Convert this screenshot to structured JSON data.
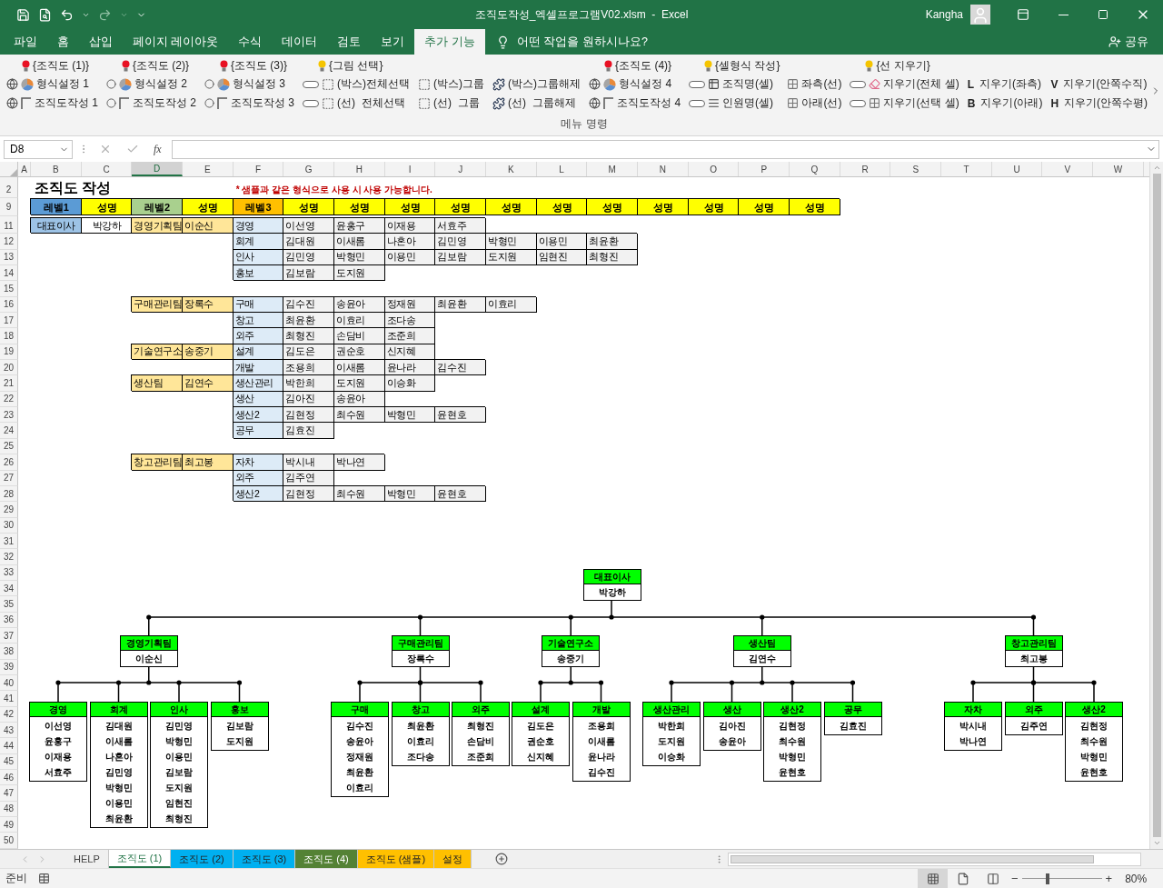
{
  "title_bar": {
    "title": "조직도작성_엑셀프로그램V02.xlsm  -  Excel",
    "user": "Kangha"
  },
  "tabs": [
    {
      "label": "파일",
      "selected": false
    },
    {
      "label": "홈",
      "selected": false
    },
    {
      "label": "삽입",
      "selected": false
    },
    {
      "label": "페이지 레이아웃",
      "selected": false
    },
    {
      "label": "수식",
      "selected": false
    },
    {
      "label": "데이터",
      "selected": false
    },
    {
      "label": "검토",
      "selected": false
    },
    {
      "label": "보기",
      "selected": false
    },
    {
      "label": "추가 기능",
      "selected": true
    }
  ],
  "tell_me": {
    "placeholder": "어떤 작업을 원하시나요?"
  },
  "share": "공유",
  "ribbon": {
    "columns": [
      {
        "heading": {
          "label": "{조직도 (1)}",
          "color": "#e81123"
        },
        "buttons": [
          {
            "label": "형식설정 1"
          },
          {
            "label": "조직도작성 1"
          }
        ]
      },
      {
        "heading": {
          "label": "{조직도 (2)}",
          "color": "#e81123"
        },
        "buttons": [
          {
            "label": "형식설정 2"
          },
          {
            "label": "조직도작성 2"
          }
        ]
      },
      {
        "heading": {
          "label": "{조직도 (3)}",
          "color": "#e81123"
        },
        "buttons": [
          {
            "label": "형식설정 3"
          },
          {
            "label": "조직도작성 3"
          }
        ]
      },
      {
        "heading": {
          "label": "{그림 선택}",
          "color": "#f5c400"
        },
        "buttons": [
          {
            "label": "(박스)전체선택"
          },
          {
            "label": "(선)  전체선택"
          }
        ]
      },
      {
        "buttons": [
          {
            "label": "(박스)그룹"
          },
          {
            "label": "(선)  그룹"
          }
        ]
      },
      {
        "buttons": [
          {
            "label": "(박스)그룹해제"
          },
          {
            "label": "(선)  그룹해제"
          }
        ]
      },
      {
        "heading": {
          "label": "{조직도 (4)}",
          "color": "#e81123"
        },
        "buttons": [
          {
            "label": "형식설정 4"
          },
          {
            "label": "조직도작성 4"
          }
        ]
      },
      {
        "heading": {
          "label": "{셀형식 작성}",
          "color": "#f5c400"
        },
        "buttons": [
          {
            "label": "조직명(셀)"
          },
          {
            "label": "인원명(셀)"
          }
        ]
      },
      {
        "buttons": [
          {
            "label": "좌측(선)"
          },
          {
            "label": "아래(선)"
          }
        ]
      },
      {
        "heading": {
          "label": "{선 지우기}",
          "color": "#f5c400"
        },
        "buttons": [
          {
            "label": "지우기(전체 셀)"
          },
          {
            "label": "지우기(선택 셀)"
          }
        ]
      },
      {
        "buttons": [
          {
            "letter": "L",
            "label": "지우기(좌측)"
          },
          {
            "letter": "B",
            "label": "지우기(아래)"
          }
        ]
      },
      {
        "buttons": [
          {
            "letter": "V",
            "label": "지우기(안쪽수직)"
          },
          {
            "letter": "H",
            "label": "지우기(안쪽수평)"
          }
        ]
      }
    ],
    "group_label": "메뉴 명령"
  },
  "formula_bar": {
    "name_box": "D8",
    "function_button": "fx"
  },
  "columns": [
    {
      "label": "A",
      "selected": false
    },
    {
      "label": "B",
      "selected": false
    },
    {
      "label": "C",
      "selected": false
    },
    {
      "label": "D",
      "selected": true
    },
    {
      "label": "E",
      "selected": false
    },
    {
      "label": "F",
      "selected": false
    },
    {
      "label": "G",
      "selected": false
    },
    {
      "label": "H",
      "selected": false
    },
    {
      "label": "I",
      "selected": false
    },
    {
      "label": "J",
      "selected": false
    },
    {
      "label": "K",
      "selected": false
    },
    {
      "label": "L",
      "selected": false
    },
    {
      "label": "M",
      "selected": false
    },
    {
      "label": "N",
      "selected": false
    },
    {
      "label": "O",
      "selected": false
    },
    {
      "label": "P",
      "selected": false
    },
    {
      "label": "Q",
      "selected": false
    },
    {
      "label": "R",
      "selected": false
    },
    {
      "label": "S",
      "selected": false
    },
    {
      "label": "T",
      "selected": false
    },
    {
      "label": "U",
      "selected": false
    },
    {
      "label": "V",
      "selected": false
    },
    {
      "label": "W",
      "selected": false
    }
  ],
  "row_numbers": [
    "2",
    "9",
    "11",
    "12",
    "13",
    "14",
    "15",
    "16",
    "17",
    "18",
    "19",
    "20",
    "21",
    "22",
    "23",
    "24",
    "25",
    "26",
    "27",
    "28",
    "29",
    "30",
    "31",
    "32",
    "33",
    "34",
    "35",
    "36",
    "37",
    "38",
    "39",
    "40",
    "41",
    "42",
    "43",
    "44",
    "45",
    "46",
    "47",
    "48",
    "49",
    "50"
  ],
  "sheet": {
    "title": "조직도 작성",
    "note": "* 샘플과 같은 형식으로 사용 시 사용 가능합니다.",
    "level_headers": [
      {
        "label": "레벨1",
        "color": "#5b9bd5"
      },
      {
        "label": "성명",
        "color": "#ffff00"
      },
      {
        "label": "레벨2",
        "color": "#a9d08e"
      },
      {
        "label": "성명",
        "color": "#ffff00"
      },
      {
        "label": "레벨3",
        "color": "#ffc000"
      },
      {
        "label": "성명",
        "color": "#ffff00"
      },
      {
        "label": "성명",
        "color": "#ffff00"
      },
      {
        "label": "성명",
        "color": "#ffff00"
      },
      {
        "label": "성명",
        "color": "#ffff00"
      },
      {
        "label": "성명",
        "color": "#ffff00"
      },
      {
        "label": "성명",
        "color": "#ffff00"
      },
      {
        "label": "성명",
        "color": "#ffff00"
      },
      {
        "label": "성명",
        "color": "#ffff00"
      },
      {
        "label": "성명",
        "color": "#ffff00"
      },
      {
        "label": "성명",
        "color": "#ffff00"
      },
      {
        "label": "성명",
        "color": "#ffff00"
      }
    ],
    "ceo": {
      "title": "대표이사",
      "name": "박강하"
    },
    "sections": [
      {
        "teams": [
          {
            "team": "경영기획팀",
            "leader": "이순신",
            "units": [
              {
                "unit": "경영",
                "members": [
                  "이선영",
                  "윤홍구",
                  "이재용",
                  "서효주"
                ]
              },
              {
                "unit": "회계",
                "members": [
                  "김대원",
                  "이새롬",
                  "나혼아",
                  "김민영",
                  "박형민",
                  "이용민",
                  "최윤환"
                ]
              },
              {
                "unit": "인사",
                "members": [
                  "김민영",
                  "박형민",
                  "이용민",
                  "김보람",
                  "도지원",
                  "임현진",
                  "최형진"
                ]
              },
              {
                "unit": "홍보",
                "members": [
                  "김보람",
                  "도지원"
                ]
              }
            ]
          }
        ]
      },
      {
        "teams": [
          {
            "team": "구매관리팀",
            "leader": "장록수",
            "units": [
              {
                "unit": "구매",
                "members": [
                  "김수진",
                  "송윤아",
                  "정재원",
                  "최윤환",
                  "이효리"
                ]
              },
              {
                "unit": "창고",
                "members": [
                  "최윤환",
                  "이효리",
                  "조다송"
                ]
              },
              {
                "unit": "외주",
                "members": [
                  "최형진",
                  "손담비",
                  "조준희"
                ]
              }
            ]
          },
          {
            "team": "기술연구소",
            "leader": "송중기",
            "units": [
              {
                "unit": "설계",
                "members": [
                  "김도은",
                  "권순호",
                  "신지혜"
                ]
              },
              {
                "unit": "개발",
                "members": [
                  "조용희",
                  "이새롬",
                  "윤나라",
                  "김수진"
                ]
              }
            ]
          },
          {
            "team": "생산팀",
            "leader": "김연수",
            "units": [
              {
                "unit": "생산관리",
                "members": [
                  "박한희",
                  "도지원",
                  "이승화"
                ]
              },
              {
                "unit": "생산",
                "members": [
                  "김아진",
                  "송윤아"
                ]
              },
              {
                "unit": "생산2",
                "members": [
                  "김현정",
                  "최수원",
                  "박형민",
                  "윤현호"
                ]
              },
              {
                "unit": "공무",
                "members": [
                  "김효진"
                ]
              }
            ]
          }
        ]
      },
      {
        "teams": [
          {
            "team": "창고관리팀",
            "leader": "최고봉",
            "units": [
              {
                "unit": "자차",
                "members": [
                  "박시내",
                  "박나연"
                ]
              },
              {
                "unit": "외주",
                "members": [
                  "김주연"
                ]
              },
              {
                "unit": "생산2",
                "members": [
                  "김현정",
                  "최수원",
                  "박형민",
                  "윤현호"
                ]
              }
            ]
          }
        ]
      }
    ]
  },
  "org_chart": {
    "root": {
      "title": "대표이사",
      "name": "박강하"
    },
    "teams": [
      {
        "title": "경영기획팀",
        "name": "이순신",
        "units": [
          {
            "title": "경영",
            "members": [
              "이선영",
              "윤홍구",
              "이재용",
              "서효주"
            ]
          },
          {
            "title": "회계",
            "members": [
              "김대원",
              "이새롬",
              "나혼아",
              "김민영",
              "박형민",
              "이용민",
              "최윤환"
            ]
          },
          {
            "title": "인사",
            "members": [
              "김민영",
              "박형민",
              "이용민",
              "김보람",
              "도지원",
              "임현진",
              "최형진"
            ]
          },
          {
            "title": "홍보",
            "members": [
              "김보람",
              "도지원"
            ]
          }
        ]
      },
      {
        "title": "구매관리팀",
        "name": "장록수",
        "units": [
          {
            "title": "구매",
            "members": [
              "김수진",
              "송윤아",
              "정재원",
              "최윤환",
              "이효리"
            ]
          },
          {
            "title": "창고",
            "members": [
              "최윤환",
              "이효리",
              "조다송"
            ]
          },
          {
            "title": "외주",
            "members": [
              "최형진",
              "손담비",
              "조준희"
            ]
          }
        ]
      },
      {
        "title": "기술연구소",
        "name": "송중기",
        "units": [
          {
            "title": "설계",
            "members": [
              "김도은",
              "권순호",
              "신지혜"
            ]
          },
          {
            "title": "개발",
            "members": [
              "조용희",
              "이새롬",
              "윤나라",
              "김수진"
            ]
          }
        ]
      },
      {
        "title": "생산팀",
        "name": "김연수",
        "units": [
          {
            "title": "생산관리",
            "members": [
              "박한희",
              "도지원",
              "이승화"
            ]
          },
          {
            "title": "생산",
            "members": [
              "김아진",
              "송윤아"
            ]
          },
          {
            "title": "생산2",
            "members": [
              "김현정",
              "최수원",
              "박형민",
              "윤현호"
            ]
          },
          {
            "title": "공무",
            "members": [
              "김효진"
            ]
          }
        ]
      },
      {
        "title": "창고관리팀",
        "name": "최고봉",
        "units": [
          {
            "title": "자차",
            "members": [
              "박시내",
              "박나연"
            ]
          },
          {
            "title": "외주",
            "members": [
              "김주연"
            ]
          },
          {
            "title": "생산2",
            "members": [
              "김현정",
              "최수원",
              "박형민",
              "윤현호"
            ]
          }
        ]
      }
    ]
  },
  "sheet_tabs": [
    {
      "label": "HELP",
      "selected": false
    },
    {
      "label": "조직도 (1)",
      "selected": true
    },
    {
      "label": "조직도 (2)",
      "selected": false,
      "color": "#00b0f0"
    },
    {
      "label": "조직도 (3)",
      "selected": false,
      "color": "#00b0f0"
    },
    {
      "label": "조직도 (4)",
      "selected": false,
      "color": "#548235"
    },
    {
      "label": "조직도 (샘플)",
      "selected": false,
      "color": "#ffc000"
    },
    {
      "label": "설정",
      "selected": false,
      "color": "#ffc000"
    }
  ],
  "status_bar": {
    "status": "준비",
    "views": [
      {
        "kind": "normal",
        "selected": true
      },
      {
        "kind": "page_layout",
        "selected": false
      },
      {
        "kind": "page_break",
        "selected": false
      }
    ],
    "zoom_out": "−",
    "zoom_in": "+",
    "zoom_slider": {
      "level": 0.32
    },
    "zoom": "80%"
  }
}
